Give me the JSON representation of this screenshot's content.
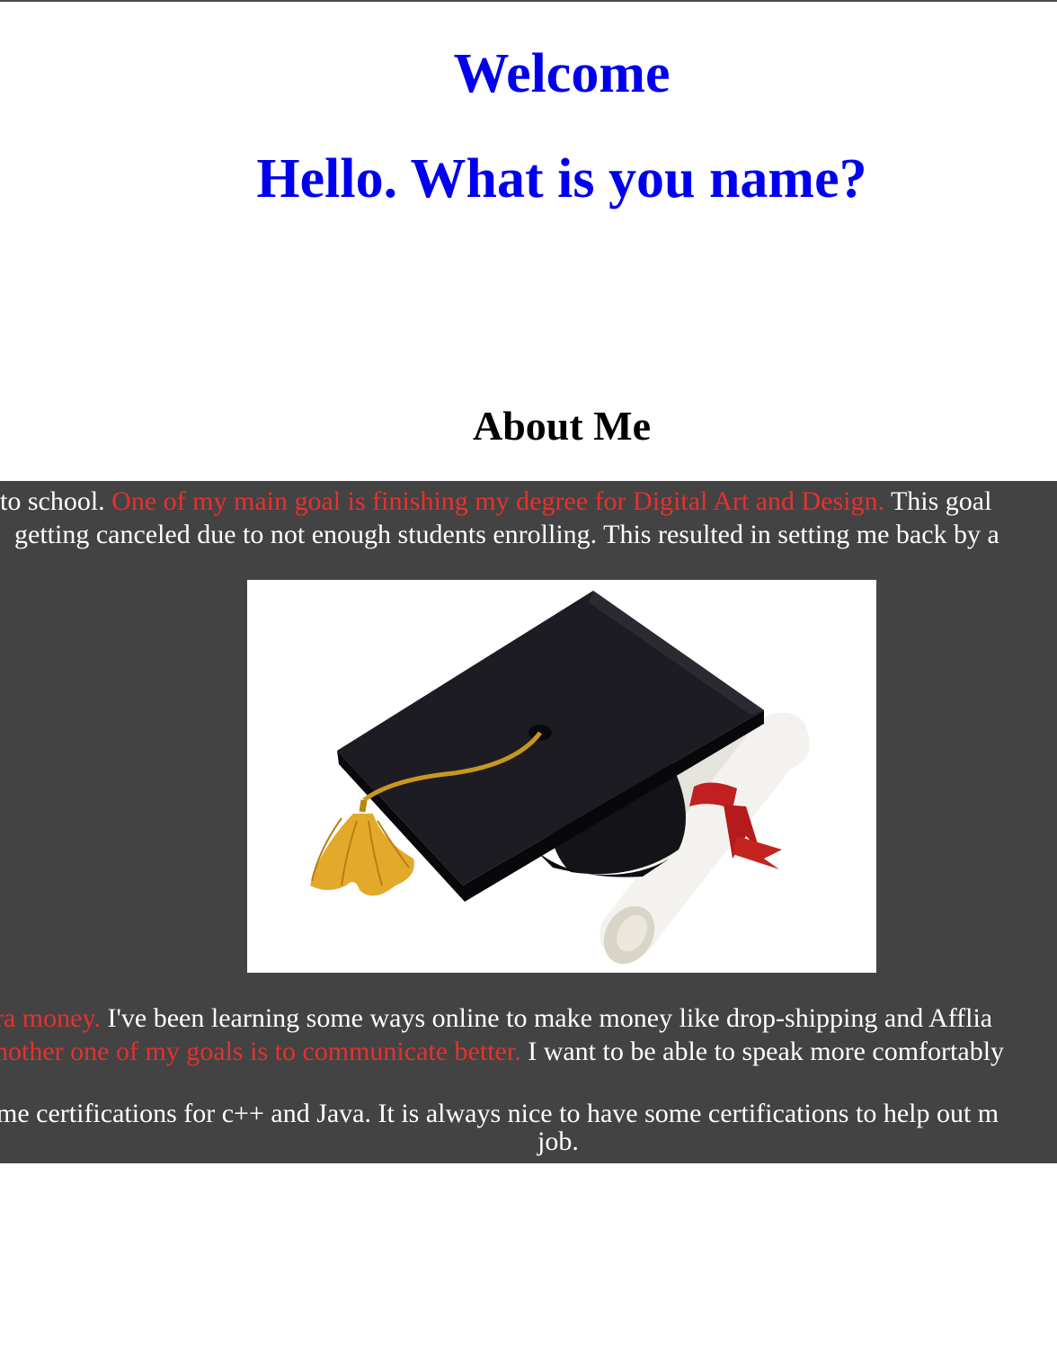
{
  "page": {
    "welcome_heading": "Welcome",
    "greeting_heading": "Hello. What is you name?",
    "about_heading": "About Me"
  },
  "about": {
    "line1": {
      "before": "to school. ",
      "highlight": "One of my main goal is finishing my degree for Digital Art and Design.",
      "after": " This goal"
    },
    "line2": "getting canceled due to not enough students enrolling. This resulted in setting me back by a",
    "line3": {
      "highlight": "ra money.",
      "after": " I've been learning some ways online to make money like drop-shipping and Afflia"
    },
    "line4": {
      "highlight": "nother one of my goals is to communicate better.",
      "after": " I want to be able to speak more comfortably"
    },
    "line5": "me certifications for c++ and Java. It is always nice to have some certifications to help out m",
    "line6": "job."
  },
  "image": {
    "subject": "graduation-cap-and-diploma"
  },
  "colors": {
    "heading_blue": "#0000ee",
    "accent_red": "#e8302e",
    "panel_bg": "#434343",
    "text_white": "#ffffff"
  }
}
